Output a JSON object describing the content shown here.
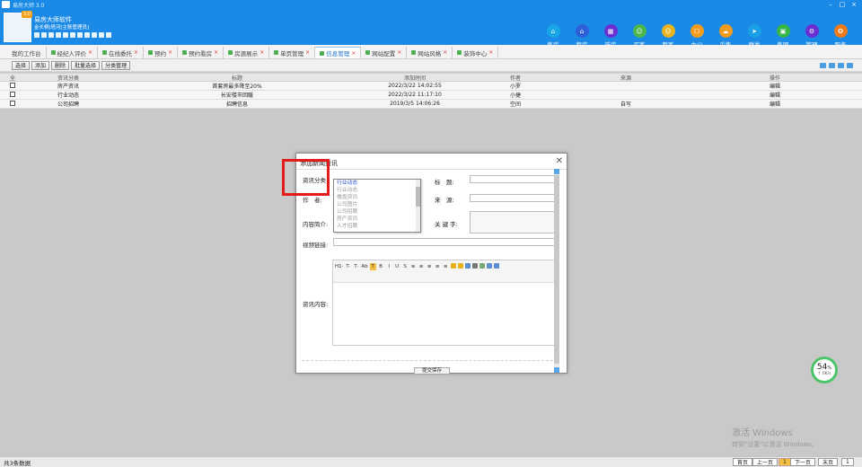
{
  "window": {
    "title": "易房大师 3.0",
    "controls": [
      "–",
      "□",
      "×"
    ]
  },
  "header": {
    "brand": "易房大师软件",
    "subtitle": "金长桐|塔河[主账管理员]",
    "logo_badge": "3.0"
  },
  "nav": [
    {
      "label": "售房",
      "icon": "house-icon",
      "color": "#19a6e6",
      "glyph": "⌂"
    },
    {
      "label": "租房",
      "icon": "rent-house-icon",
      "color": "#2c5fd8",
      "glyph": "⌂"
    },
    {
      "label": "新房",
      "icon": "building-icon",
      "color": "#6a2fd0",
      "glyph": "▦"
    },
    {
      "label": "买客",
      "icon": "buyer-icon",
      "color": "#4cb84c",
      "glyph": "☺"
    },
    {
      "label": "租客",
      "icon": "tenant-icon",
      "color": "#e9b320",
      "glyph": "☺"
    },
    {
      "label": "办公",
      "icon": "office-icon",
      "color": "#f39b1c",
      "glyph": "☐"
    },
    {
      "label": "采集",
      "icon": "cloud-icon",
      "color": "#f39b1c",
      "glyph": "☁"
    },
    {
      "label": "群发",
      "icon": "send-icon",
      "color": "#1aa0e6",
      "glyph": "➤"
    },
    {
      "label": "集网",
      "icon": "web-icon",
      "color": "#38b548",
      "glyph": "▣"
    },
    {
      "label": "管理",
      "icon": "gear-icon",
      "color": "#6a2fd0",
      "glyph": "⚙"
    },
    {
      "label": "服务",
      "icon": "service-icon",
      "color": "#f07a1a",
      "glyph": "✪"
    }
  ],
  "tabs": [
    {
      "label": "我的工作台",
      "color": "",
      "closable": false,
      "active": false
    },
    {
      "label": "经纪人评价",
      "color": "#4caf50",
      "closable": true,
      "active": false
    },
    {
      "label": "在线委托",
      "color": "#4caf50",
      "closable": true,
      "active": false
    },
    {
      "label": "预约",
      "color": "#4caf50",
      "closable": true,
      "active": false
    },
    {
      "label": "预约看房",
      "color": "#4caf50",
      "closable": true,
      "active": false
    },
    {
      "label": "房源展示",
      "color": "#4caf50",
      "closable": true,
      "active": false
    },
    {
      "label": "单页管理",
      "color": "#4caf50",
      "closable": true,
      "active": false
    },
    {
      "label": "信息管理",
      "color": "#4caf50",
      "closable": true,
      "active": true
    },
    {
      "label": "网站配置",
      "color": "#4caf50",
      "closable": true,
      "active": false
    },
    {
      "label": "网站风格",
      "color": "#4caf50",
      "closable": true,
      "active": false
    },
    {
      "label": "装饰中心",
      "color": "#4caf50",
      "closable": true,
      "active": false
    }
  ],
  "toolbar": [
    "选择",
    "添加",
    "删除",
    "批量选择",
    "分类管理"
  ],
  "table": {
    "headers": [
      "全",
      "资讯分类",
      "标题",
      "添加时间",
      "作者",
      "来源",
      "操作"
    ],
    "rows": [
      {
        "category": "房产资讯",
        "title": "首套房最多降至20%",
        "time": "2022/3/22 14:02:55",
        "author": "小罗",
        "source": "",
        "action": "编辑"
      },
      {
        "category": "行业动态",
        "title": "长安楼市回暖",
        "time": "2022/3/22 11:17:10",
        "author": "小捷",
        "source": "",
        "action": "编辑"
      },
      {
        "category": "公司招聘",
        "title": "招聘信息",
        "time": "2019/3/5 14:06:26",
        "author": "空间",
        "source": "自写",
        "action": "编辑"
      }
    ]
  },
  "dialog": {
    "title": "添加新闻资讯",
    "labels": {
      "category": "资讯分类:",
      "author": "作　者:",
      "intro": "内容简介:",
      "video": "视频链接:",
      "content": "资讯内容:",
      "title": "标　题:",
      "source": "来　源:",
      "keywords": "关 键 字:"
    },
    "category_options": [
      "行业动态",
      "行业动态",
      "楼盘资讯",
      "公司图片",
      "公司招聘",
      "房产资讯",
      "人才招聘"
    ],
    "submit": "提交保存"
  },
  "editor_toolbar": [
    "H1·",
    "T·",
    "T·",
    "Ab",
    "T",
    "B",
    "I",
    "U",
    "S",
    "≡",
    "≡",
    "≡",
    "≡",
    "≡"
  ],
  "status": {
    "count": "共3条数据",
    "pager": [
      "首页",
      "上一页",
      "1",
      "下一页",
      "末页",
      "1"
    ]
  },
  "gauge": {
    "percent": "54",
    "unit": "%",
    "speed": "↑ 0K/s"
  },
  "watermark": {
    "line1": "激活 Windows",
    "line2": "转到\"设置\"以激活 Windows。"
  }
}
